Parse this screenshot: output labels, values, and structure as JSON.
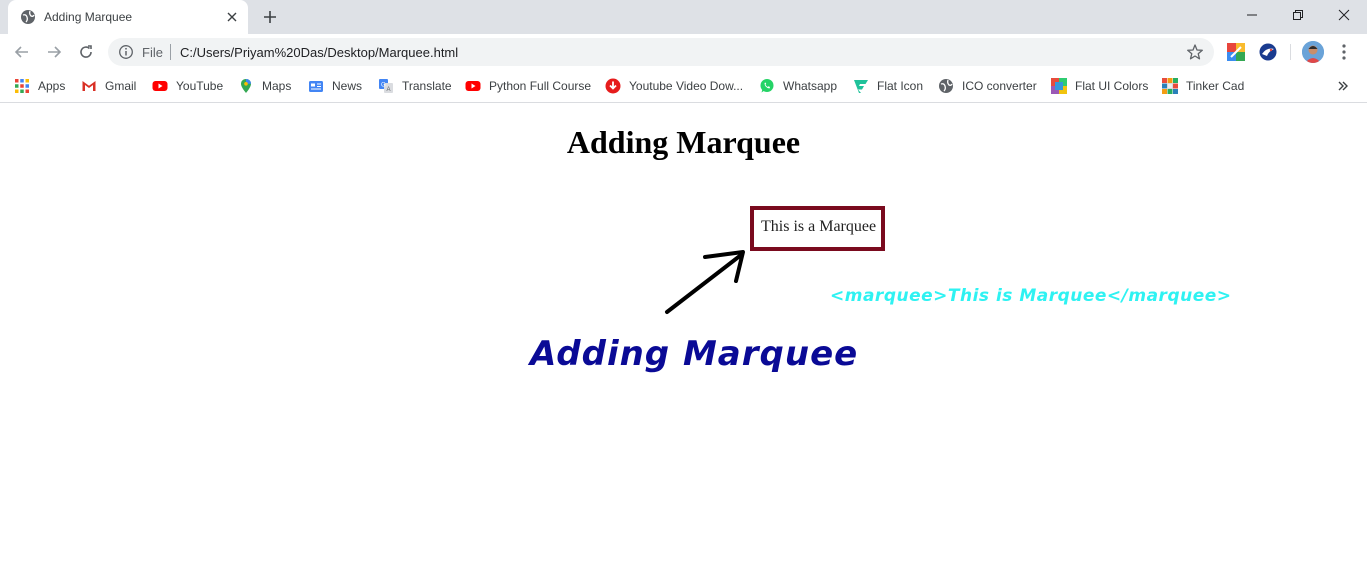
{
  "browser": {
    "tab": {
      "title": "Adding Marquee"
    },
    "omnibox": {
      "scheme_label": "File",
      "url": "C:/Users/Priyam%20Das/Desktop/Marquee.html"
    },
    "bookmarks": [
      {
        "label": "Apps",
        "icon": "apps-grid-icon"
      },
      {
        "label": "Gmail",
        "icon": "gmail-icon"
      },
      {
        "label": "YouTube",
        "icon": "youtube-icon"
      },
      {
        "label": "Maps",
        "icon": "maps-icon"
      },
      {
        "label": "News",
        "icon": "news-icon"
      },
      {
        "label": "Translate",
        "icon": "translate-icon"
      },
      {
        "label": "Python Full Course",
        "icon": "youtube-icon"
      },
      {
        "label": "Youtube Video Dow...",
        "icon": "download-icon"
      },
      {
        "label": "Whatsapp",
        "icon": "whatsapp-icon"
      },
      {
        "label": "Flat Icon",
        "icon": "flaticon-icon"
      },
      {
        "label": "ICO converter",
        "icon": "globe-icon"
      },
      {
        "label": "Flat UI Colors",
        "icon": "color-palette-icon"
      },
      {
        "label": "Tinker Cad",
        "icon": "tinkercad-icon"
      }
    ]
  },
  "page": {
    "heading": "Adding Marquee",
    "marquee_text": "This is a Marquee",
    "code_annotation": "<marquee>This is Marquee</marquee>",
    "handwritten_title": "Adding Marquee"
  },
  "colors": {
    "marquee_border": "#7a0a1e",
    "code_annotation": "#2ef2f2",
    "handwritten_title": "#0a0a96",
    "tab_strip": "#dee1e6"
  }
}
